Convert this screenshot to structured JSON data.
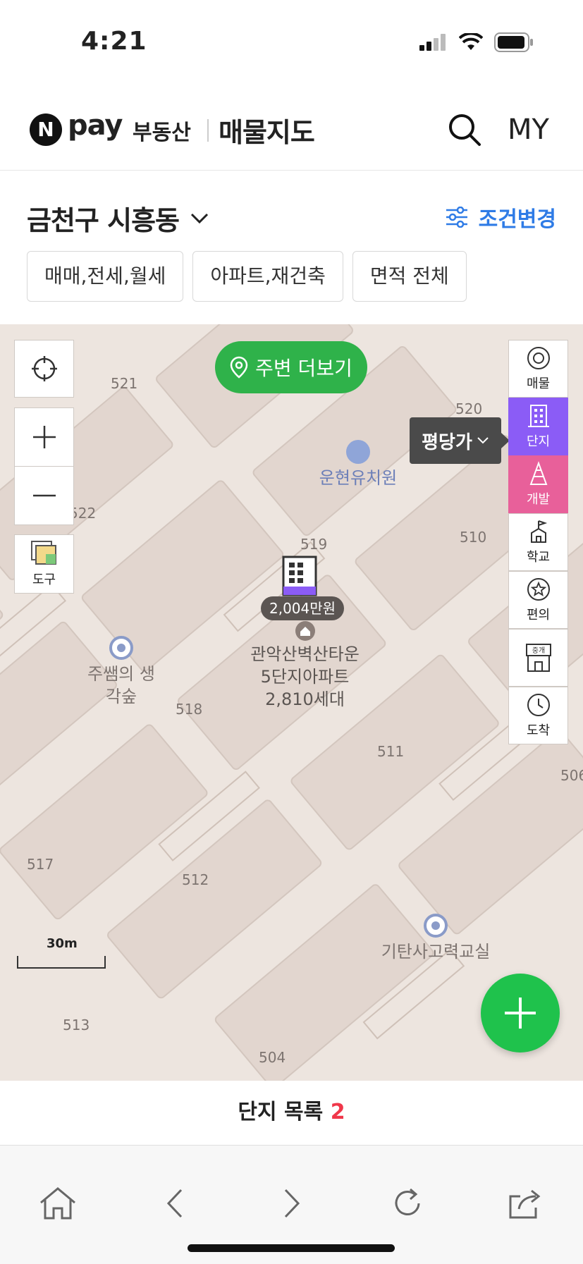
{
  "status_bar": {
    "time": "4:21"
  },
  "header": {
    "logo_n": "N",
    "logo_pay": "pay",
    "logo_sub": "부동산",
    "page_name": "매물지도",
    "my_label": "MY"
  },
  "filter": {
    "region": "금천구 시흥동",
    "condition_label": "조건변경",
    "chips": [
      "매매,전세,월세",
      "아파트,재건축",
      "면적 전체"
    ]
  },
  "map": {
    "nearby_label": "주변 더보기",
    "tool_label": "도구",
    "pyeong_label": "평당가",
    "side_menu": [
      {
        "label": "매물",
        "icon": "listing-icon"
      },
      {
        "label": "단지",
        "icon": "building-icon"
      },
      {
        "label": "개발",
        "icon": "development-icon"
      },
      {
        "label": "학교",
        "icon": "school-icon"
      },
      {
        "label": "편의",
        "icon": "convenience-icon"
      },
      {
        "label": "중개",
        "icon": "broker-icon"
      },
      {
        "label": "도착",
        "icon": "clock-icon"
      }
    ],
    "lot_numbers": [
      "521",
      "520",
      "522",
      "519",
      "510",
      "518",
      "511",
      "506",
      "517",
      "512",
      "513",
      "504"
    ],
    "pois": [
      "운현유치원",
      "주쌤의 생각숲",
      "기탄사고력교실"
    ],
    "complex": {
      "price": "2,004만원",
      "name_line1": "관악산벽산타운",
      "name_line2": "5단지아파트",
      "households": "2,810세대"
    },
    "scale_label": "30m"
  },
  "list_bar": {
    "label": "단지 목록",
    "count": "2"
  },
  "colors": {
    "accent_blue": "#2e7be6",
    "green": "#2fb24a",
    "purple": "#8b5cf6",
    "pink": "#e8609a",
    "count_red": "#f0374a"
  }
}
